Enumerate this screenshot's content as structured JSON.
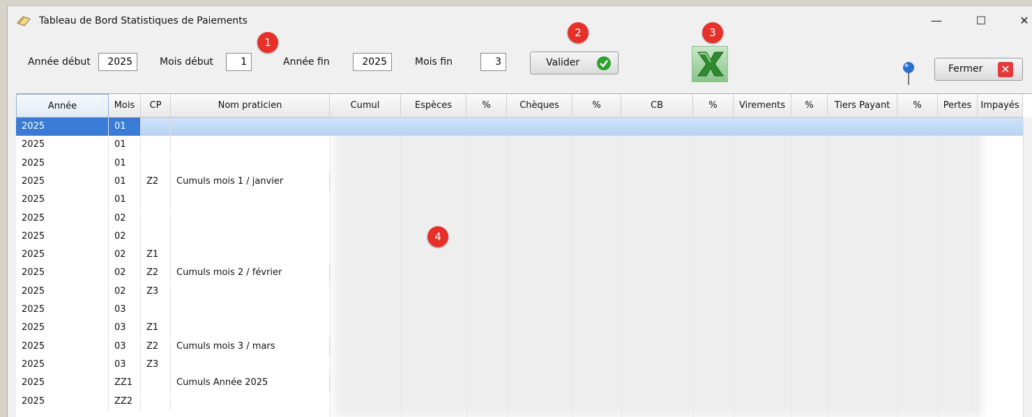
{
  "window": {
    "title": "Tableau de Bord Statistiques de Paiements",
    "minimize": "—",
    "maximize": "☐",
    "close": "✕"
  },
  "filters": {
    "annee_debut_label": "Année début",
    "annee_debut": "2025",
    "mois_debut_label": "Mois début",
    "mois_debut": "1",
    "annee_fin_label": "Année fin",
    "annee_fin": "2025",
    "mois_fin_label": "Mois fin",
    "mois_fin": "3"
  },
  "buttons": {
    "valider": "Valider",
    "fermer": "Fermer"
  },
  "icons": {
    "check": "check-circle-icon",
    "excel": "excel-icon",
    "pin": "map-pin-icon",
    "close": "close-red-icon"
  },
  "badges": [
    "1",
    "2",
    "3",
    "4"
  ],
  "table": {
    "columns": [
      "Année",
      "Mois",
      "CP",
      "Nom praticien",
      "Cumul",
      "Espèces",
      "%",
      "Chèques",
      "%",
      "CB",
      "%",
      "Virements",
      "%",
      "Tiers Payant",
      "%",
      "Pertes",
      "Impayés"
    ],
    "rows": [
      {
        "annee": "2025",
        "mois": "01",
        "cp": "",
        "nom": ""
      },
      {
        "annee": "2025",
        "mois": "01",
        "cp": "",
        "nom": ""
      },
      {
        "annee": "2025",
        "mois": "01",
        "cp": "",
        "nom": ""
      },
      {
        "annee": "2025",
        "mois": "01",
        "cp": "Z2",
        "nom": "Cumuls mois 1 / janvier"
      },
      {
        "annee": "2025",
        "mois": "01",
        "cp": "",
        "nom": ""
      },
      {
        "annee": "2025",
        "mois": "02",
        "cp": "",
        "nom": ""
      },
      {
        "annee": "2025",
        "mois": "02",
        "cp": "",
        "nom": ""
      },
      {
        "annee": "2025",
        "mois": "02",
        "cp": "Z1",
        "nom": ""
      },
      {
        "annee": "2025",
        "mois": "02",
        "cp": "Z2",
        "nom": "Cumuls mois 2 / février"
      },
      {
        "annee": "2025",
        "mois": "02",
        "cp": "Z3",
        "nom": ""
      },
      {
        "annee": "2025",
        "mois": "03",
        "cp": "",
        "nom": ""
      },
      {
        "annee": "2025",
        "mois": "03",
        "cp": "Z1",
        "nom": ""
      },
      {
        "annee": "2025",
        "mois": "03",
        "cp": "Z2",
        "nom": "Cumuls mois 3 / mars"
      },
      {
        "annee": "2025",
        "mois": "03",
        "cp": "Z3",
        "nom": ""
      },
      {
        "annee": "2025",
        "mois": "ZZ1",
        "cp": "",
        "nom": "Cumuls Année 2025"
      },
      {
        "annee": "2025",
        "mois": "ZZ2",
        "cp": "",
        "nom": ""
      }
    ]
  },
  "colors": {
    "badge": "#e8302a",
    "selection": "#3a7bd5",
    "excel_green": "#2e8b2e",
    "check_green": "#2ea12e"
  }
}
